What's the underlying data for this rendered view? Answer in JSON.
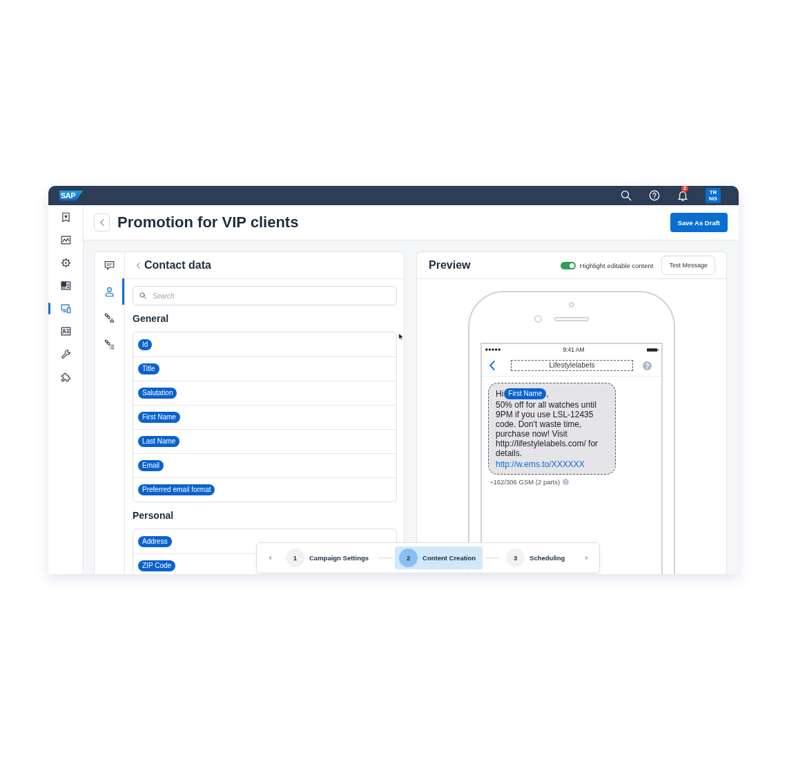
{
  "shell_bar": {
    "logo": "SAP",
    "notification_count": "2",
    "avatar_initials": "TR NG"
  },
  "side_nav": {
    "items": [
      {
        "selected": false
      },
      {
        "selected": false
      },
      {
        "selected": false
      },
      {
        "selected": false
      },
      {
        "selected": true
      },
      {
        "selected": false
      },
      {
        "selected": false
      },
      {
        "selected": false
      }
    ]
  },
  "header": {
    "title": "Promotion for VIP clients",
    "save_button": "Save As Draft"
  },
  "contact_panel": {
    "tabs": [
      {
        "selected": false
      },
      {
        "selected": true
      },
      {
        "selected": false
      },
      {
        "selected": false
      }
    ],
    "title": "Contact data",
    "search": {
      "placeholder": "Search"
    },
    "groups": [
      {
        "title": "General",
        "fields": [
          "Id",
          "Title",
          "Salutation",
          "First Name",
          "Last Name",
          "Email",
          "Preferred email format"
        ]
      },
      {
        "title": "Personal",
        "fields": [
          "Address",
          "ZIP Code"
        ]
      }
    ]
  },
  "preview": {
    "title": "Preview",
    "highlight_toggle": {
      "label": "Highlight editable content",
      "on": true
    },
    "test_button": "Test Message",
    "phone": {
      "time": "9:41 AM",
      "sender": "Lifestylelabels",
      "message": {
        "greeting": "Hi",
        "token": "First Name",
        "punctuation": ",",
        "body": "50% off for all watches until 9PM if you use LSL-12435 code. Don't waste time, purchase now! Visit http://lifestylelabels.com/ for details.",
        "link": "http://w.ems.to/XXXXXX"
      },
      "counter": "~162/306 GSM (2 parts)"
    }
  },
  "stepper": {
    "steps": [
      {
        "number": "1",
        "label": "Campaign Settings",
        "selected": false
      },
      {
        "number": "2",
        "label": "Content Creation",
        "selected": true
      },
      {
        "number": "3",
        "label": "Scheduling",
        "selected": false
      }
    ]
  }
}
